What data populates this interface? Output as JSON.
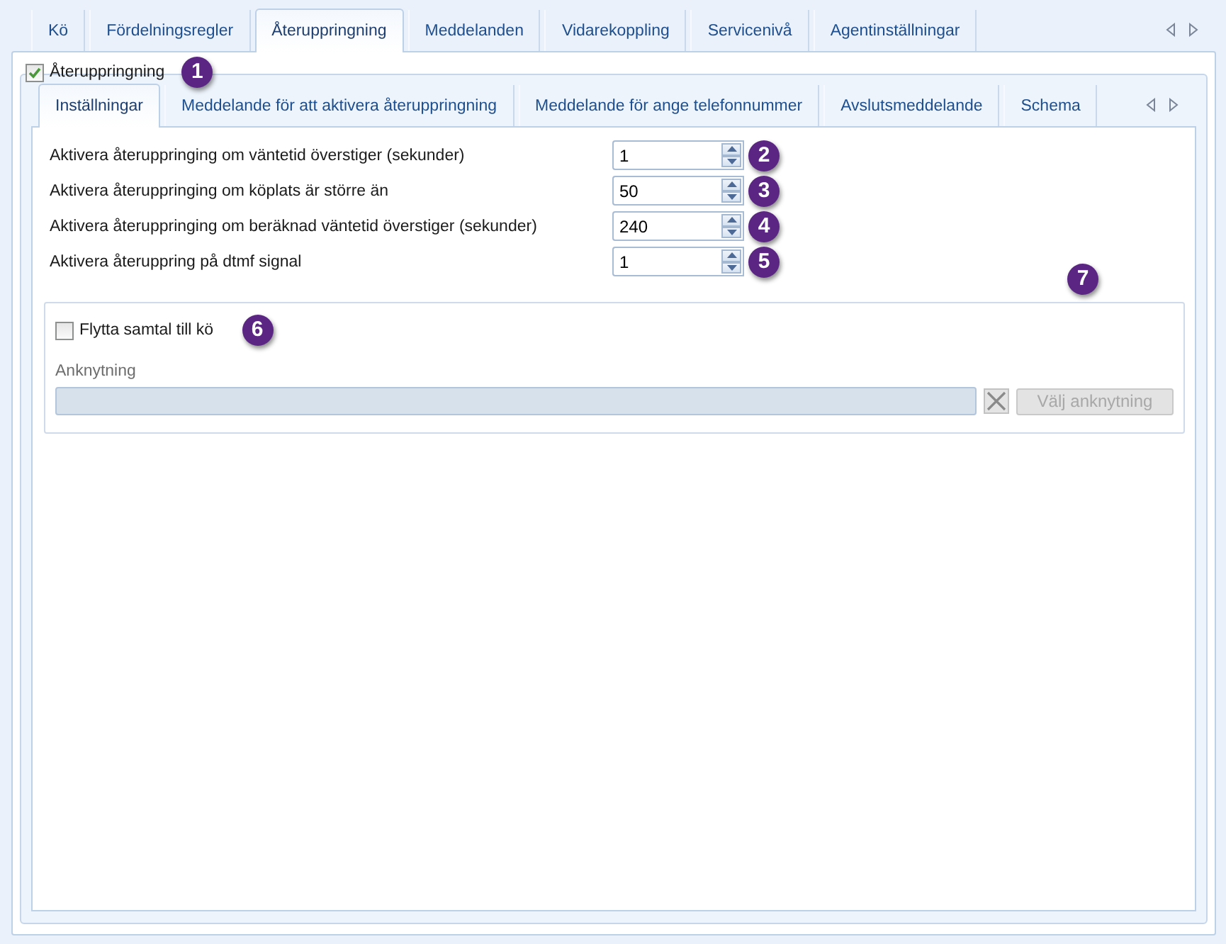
{
  "outer_tabs": [
    {
      "label": "Kö",
      "selected": false
    },
    {
      "label": "Fördelningsregler",
      "selected": false
    },
    {
      "label": "Återuppringning",
      "selected": true
    },
    {
      "label": "Meddelanden",
      "selected": false
    },
    {
      "label": "Vidarekoppling",
      "selected": false
    },
    {
      "label": "Servicenivå",
      "selected": false
    },
    {
      "label": "Agentinställningar",
      "selected": false
    }
  ],
  "callback": {
    "label": "Återuppringning",
    "checked": true,
    "callout": "1"
  },
  "inner_tabs": [
    {
      "label": "Inställningar",
      "selected": true
    },
    {
      "label": "Meddelande för att aktivera återuppringning",
      "selected": false
    },
    {
      "label": "Meddelande för ange telefonnummer",
      "selected": false
    },
    {
      "label": "Avslutsmeddelande",
      "selected": false
    },
    {
      "label": "Schema",
      "selected": false
    }
  ],
  "settings": [
    {
      "label": "Aktivera återuppringing om väntetid överstiger (sekunder)",
      "value": "1",
      "callout": "2"
    },
    {
      "label": "Aktivera återuppringing om köplats är större än",
      "value": "50",
      "callout": "3"
    },
    {
      "label": "Aktivera återuppringing om beräknad väntetid överstiger (sekunder)",
      "value": "240",
      "callout": "4"
    },
    {
      "label": "Aktivera återuppring på dtmf signal",
      "value": "1",
      "callout": "5"
    }
  ],
  "move_call": {
    "label": "Flytta samtal till kö",
    "checked": false,
    "callout": "6"
  },
  "extension": {
    "label": "Anknytning",
    "disabled": true,
    "button": {
      "label": "Välj anknytning",
      "callout": "7"
    }
  }
}
